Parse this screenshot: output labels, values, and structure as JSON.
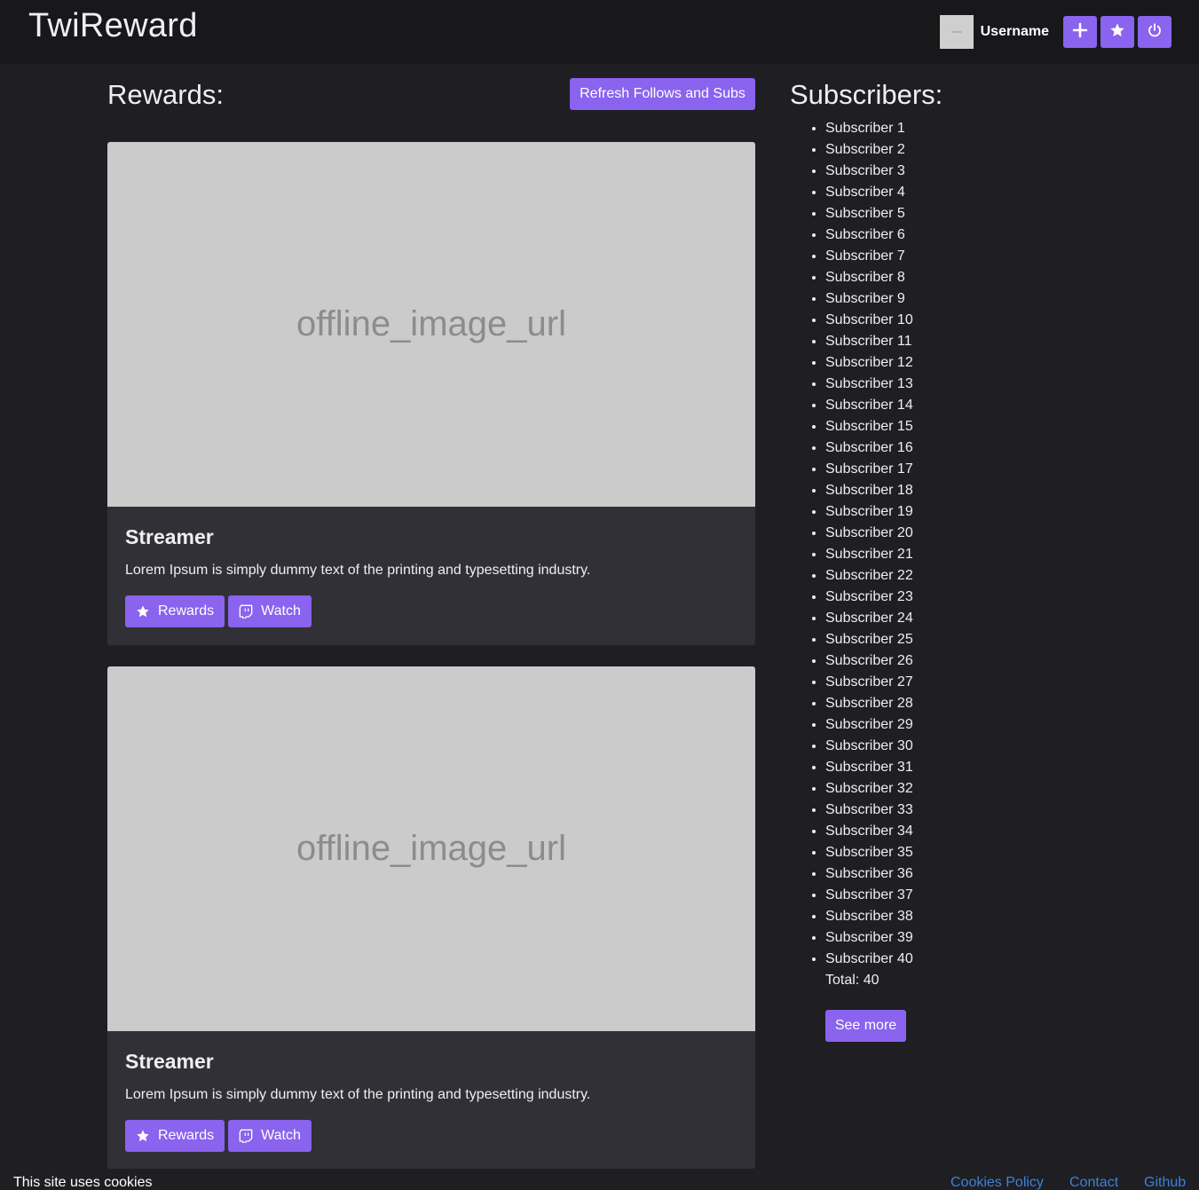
{
  "header": {
    "brand": "TwiReward",
    "username": "Username"
  },
  "actions": {
    "add_icon": "plus-icon",
    "favorites_icon": "star-icon",
    "logout_icon": "power-icon"
  },
  "rewards": {
    "title": "Rewards:",
    "refresh_label": "Refresh Follows and Subs",
    "cards": [
      {
        "image_alt": "offline_image_url",
        "title": "Streamer",
        "text": "Lorem Ipsum is simply dummy text of the printing and typesetting industry.",
        "rewards_label": "Rewards",
        "watch_label": "Watch"
      },
      {
        "image_alt": "offline_image_url",
        "title": "Streamer",
        "text": "Lorem Ipsum is simply dummy text of the printing and typesetting industry.",
        "rewards_label": "Rewards",
        "watch_label": "Watch"
      }
    ]
  },
  "subscribers": {
    "title": "Subscribers:",
    "items": [
      "Subscriber 1",
      "Subscriber 2",
      "Subscriber 3",
      "Subscriber 4",
      "Subscriber 5",
      "Subscriber 6",
      "Subscriber 7",
      "Subscriber 8",
      "Subscriber 9",
      "Subscriber 10",
      "Subscriber 11",
      "Subscriber 12",
      "Subscriber 13",
      "Subscriber 14",
      "Subscriber 15",
      "Subscriber 16",
      "Subscriber 17",
      "Subscriber 18",
      "Subscriber 19",
      "Subscriber 20",
      "Subscriber 21",
      "Subscriber 22",
      "Subscriber 23",
      "Subscriber 24",
      "Subscriber 25",
      "Subscriber 26",
      "Subscriber 27",
      "Subscriber 28",
      "Subscriber 29",
      "Subscriber 30",
      "Subscriber 31",
      "Subscriber 32",
      "Subscriber 33",
      "Subscriber 34",
      "Subscriber 35",
      "Subscriber 36",
      "Subscriber 37",
      "Subscriber 38",
      "Subscriber 39",
      "Subscriber 40"
    ],
    "total": "Total: 40",
    "see_more_label": "See more"
  },
  "footer": {
    "cookie_text": "This site uses cookies",
    "links": [
      "Cookies Policy",
      "Contact",
      "Github"
    ]
  },
  "colors": {
    "accent": "#8a63ee",
    "background": "#1f1f23",
    "navbar": "#18181b",
    "card": "#303036",
    "link": "#3b82d6"
  }
}
